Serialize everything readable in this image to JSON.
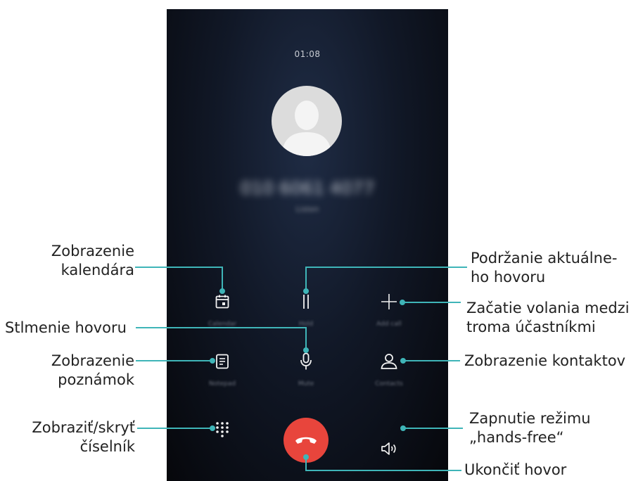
{
  "call": {
    "timer": "01:08",
    "number_blurred": "010 6061 4077",
    "sub_blurred": "Listen"
  },
  "controls": [
    {
      "id": "calendar",
      "label": "Calendar",
      "icon": "calendar-icon"
    },
    {
      "id": "hold",
      "label": "Hold",
      "icon": "pause-icon"
    },
    {
      "id": "add_call",
      "label": "Add call",
      "icon": "plus-icon"
    },
    {
      "id": "notepad",
      "label": "Notepad",
      "icon": "notepad-icon"
    },
    {
      "id": "mute",
      "label": "Mute",
      "icon": "microphone-icon"
    },
    {
      "id": "contacts",
      "label": "Contacts",
      "icon": "person-icon"
    },
    {
      "id": "dialpad",
      "label": "",
      "icon": "dialpad-icon"
    },
    {
      "id": "end_call",
      "label": "",
      "icon": "phone-hangup-icon"
    },
    {
      "id": "speaker",
      "label": "",
      "icon": "speaker-icon"
    }
  ],
  "annotations": {
    "calendar": [
      "Zobrazenie",
      "kalendára"
    ],
    "mute": [
      "Stlmenie hovoru"
    ],
    "notepad": [
      "Zobrazenie",
      "poznámok"
    ],
    "dialpad": [
      "Zobraziť/skryť",
      "číselník"
    ],
    "hold": [
      "Podržanie aktuálne-",
      "ho hovoru"
    ],
    "add_call": [
      "Začatie volania medzi",
      "troma účastníkmi"
    ],
    "contacts": [
      "Zobrazenie kontaktov"
    ],
    "speaker": [
      "Zapnutie režimu",
      "„hands-free“"
    ],
    "end_call": [
      "Ukončiť hovor"
    ]
  },
  "colors": {
    "callout_line": "#3fb5b8",
    "end_call_red": "#e8453c",
    "icon_white": "#f2f2f2"
  }
}
